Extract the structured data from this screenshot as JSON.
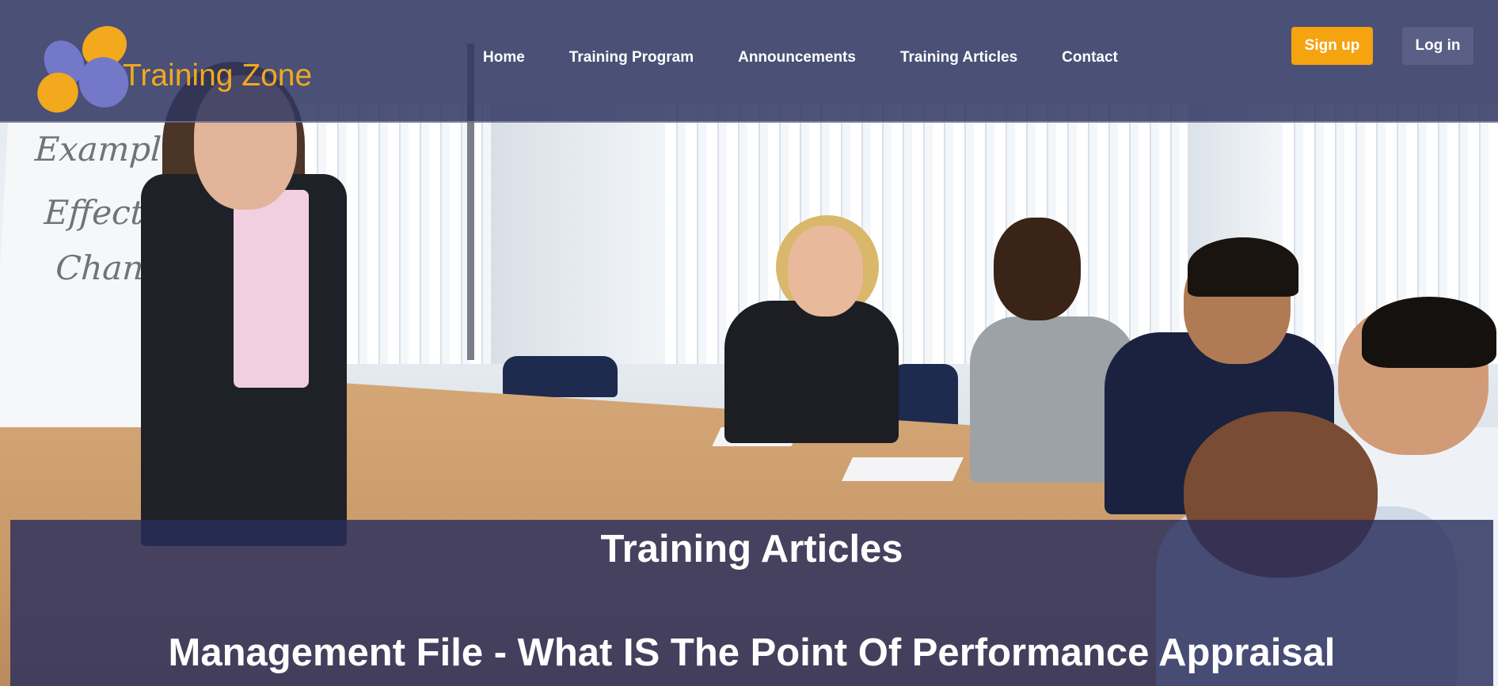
{
  "header": {
    "logo_text": "Training Zone",
    "nav": [
      {
        "label": "Home"
      },
      {
        "label": "Training Program"
      },
      {
        "label": "Announcements"
      },
      {
        "label": "Training Articles"
      },
      {
        "label": "Contact"
      }
    ],
    "signup_label": "Sign up",
    "login_label": "Log in"
  },
  "hero": {
    "flipchart_lines": [
      "Example",
      "Effect",
      "Chan"
    ]
  },
  "banner": {
    "title": "Training Articles",
    "subtitle": "Management File - What IS The Point Of Performance Appraisal"
  },
  "colors": {
    "header_bg": "#2f3560",
    "accent_orange": "#f5a30f",
    "logo_purple": "#7378c9",
    "login_bg": "#5b5f86"
  }
}
